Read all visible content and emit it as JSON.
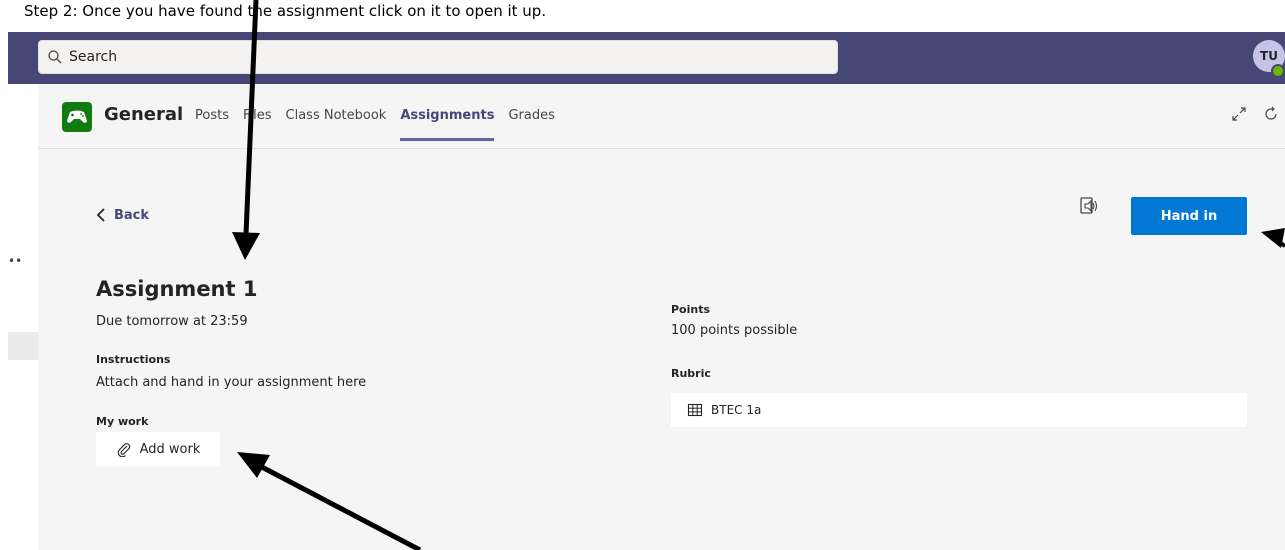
{
  "caption": "Step 2: Once you have found the assignment click on it to open it up.",
  "search": {
    "placeholder": "Search"
  },
  "user": {
    "initials": "TU"
  },
  "channel": {
    "name": "General"
  },
  "tabs": [
    {
      "label": "Posts",
      "active": false
    },
    {
      "label": "Files",
      "active": false
    },
    {
      "label": "Class Notebook",
      "active": false
    },
    {
      "label": "Assignments",
      "active": true
    },
    {
      "label": "Grades",
      "active": false
    }
  ],
  "toolbar": {
    "back_label": "Back",
    "hand_in_label": "Hand in"
  },
  "assignment": {
    "title": "Assignment 1",
    "due": "Due tomorrow at 23:59",
    "instructions_label": "Instructions",
    "instructions": "Attach and hand in your assignment here",
    "my_work_label": "My work",
    "add_work_label": "Add work"
  },
  "points": {
    "label": "Points",
    "value": "100 points possible"
  },
  "rubric": {
    "label": "Rubric",
    "name": "BTEC 1a"
  },
  "colors": {
    "accent": "#6264a7",
    "topbar": "#464775",
    "primary_button": "#0078d4",
    "team_logo": "#107c10"
  }
}
